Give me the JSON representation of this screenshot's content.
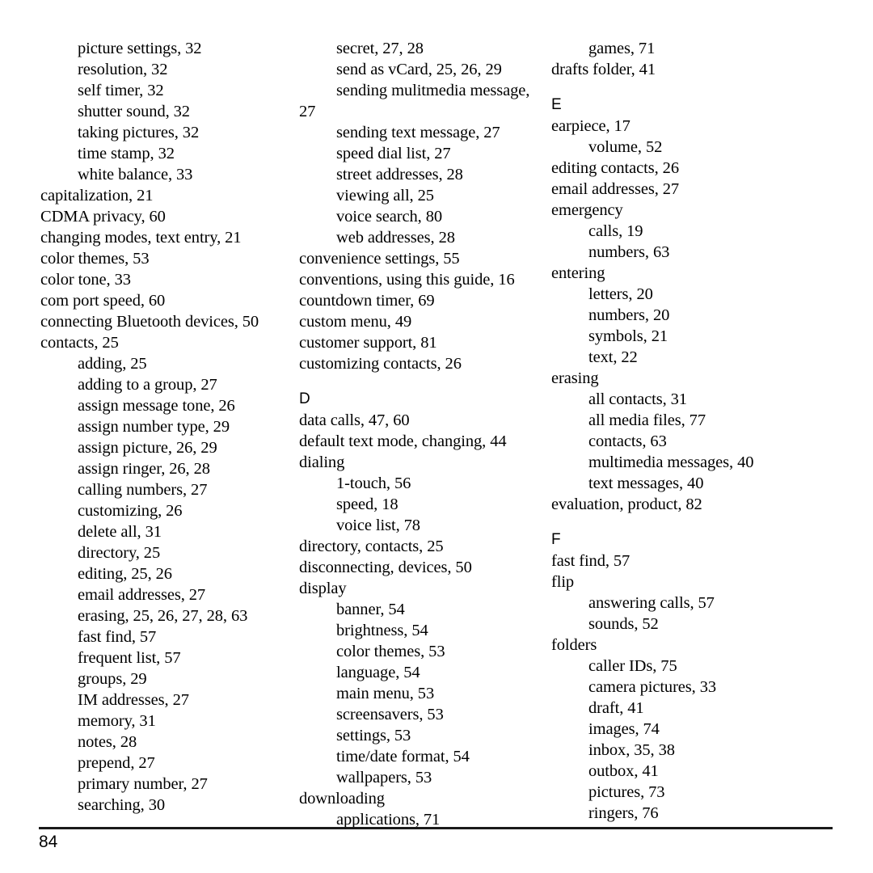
{
  "page": {
    "number": "84",
    "type": "index"
  },
  "columns": [
    {
      "name": "column-1",
      "lines": [
        {
          "level": 1,
          "text": "picture settings, 32"
        },
        {
          "level": 1,
          "text": "resolution, 32"
        },
        {
          "level": 1,
          "text": "self timer, 32"
        },
        {
          "level": 1,
          "text": "shutter sound, 32"
        },
        {
          "level": 1,
          "text": "taking pictures, 32"
        },
        {
          "level": 1,
          "text": "time stamp, 32"
        },
        {
          "level": 1,
          "text": "white balance, 33"
        },
        {
          "level": 0,
          "text": "capitalization, 21"
        },
        {
          "level": 0,
          "text": "CDMA privacy, 60"
        },
        {
          "level": 0,
          "text": "changing modes, text entry, 21"
        },
        {
          "level": 0,
          "text": "color themes, 53"
        },
        {
          "level": 0,
          "text": "color tone, 33"
        },
        {
          "level": 0,
          "text": "com port speed, 60"
        },
        {
          "level": 0,
          "text": "connecting Bluetooth devices, 50"
        },
        {
          "level": 0,
          "text": "contacts, 25"
        },
        {
          "level": 1,
          "text": "adding, 25"
        },
        {
          "level": 1,
          "text": "adding to a group, 27"
        },
        {
          "level": 1,
          "text": "assign message tone, 26"
        },
        {
          "level": 1,
          "text": "assign number type, 29"
        },
        {
          "level": 1,
          "text": "assign picture, 26, 29"
        },
        {
          "level": 1,
          "text": "assign ringer, 26, 28"
        },
        {
          "level": 1,
          "text": "calling numbers, 27"
        },
        {
          "level": 1,
          "text": "customizing, 26"
        },
        {
          "level": 1,
          "text": "delete all, 31"
        },
        {
          "level": 1,
          "text": "directory, 25"
        },
        {
          "level": 1,
          "text": "editing, 25, 26"
        },
        {
          "level": 1,
          "text": "email addresses, 27"
        },
        {
          "level": 1,
          "text": "erasing, 25, 26, 27, 28, 63"
        },
        {
          "level": 1,
          "text": "fast find, 57"
        },
        {
          "level": 1,
          "text": "frequent list, 57"
        },
        {
          "level": 1,
          "text": "groups, 29"
        },
        {
          "level": 1,
          "text": "IM addresses, 27"
        },
        {
          "level": 1,
          "text": "memory, 31"
        },
        {
          "level": 1,
          "text": "notes, 28"
        },
        {
          "level": 1,
          "text": "prepend, 27"
        },
        {
          "level": 1,
          "text": "primary number, 27"
        },
        {
          "level": 1,
          "text": "searching, 30"
        }
      ]
    },
    {
      "name": "column-2",
      "lines": [
        {
          "level": 1,
          "text": "secret, 27, 28"
        },
        {
          "level": 1,
          "text": "send as vCard, 25, 26, 29"
        },
        {
          "level": 1,
          "text": "sending mulitmedia message,"
        },
        {
          "level": "wrap",
          "text": "27"
        },
        {
          "level": 1,
          "text": "sending text message, 27"
        },
        {
          "level": 1,
          "text": "speed dial list, 27"
        },
        {
          "level": 1,
          "text": "street addresses, 28"
        },
        {
          "level": 1,
          "text": "viewing all, 25"
        },
        {
          "level": 1,
          "text": "voice search, 80"
        },
        {
          "level": 1,
          "text": "web addresses, 28"
        },
        {
          "level": 0,
          "text": "convenience settings, 55"
        },
        {
          "level": 0,
          "text": "conventions, using this guide, 16"
        },
        {
          "level": 0,
          "text": "countdown timer, 69"
        },
        {
          "level": 0,
          "text": "custom menu, 49"
        },
        {
          "level": 0,
          "text": "customer support, 81"
        },
        {
          "level": 0,
          "text": "customizing contacts, 26"
        },
        {
          "level": "letter",
          "text": "D"
        },
        {
          "level": 0,
          "text": "data calls, 47, 60"
        },
        {
          "level": 0,
          "text": "default text mode, changing, 44"
        },
        {
          "level": 0,
          "text": "dialing"
        },
        {
          "level": 1,
          "text": "1-touch, 56"
        },
        {
          "level": 1,
          "text": "speed, 18"
        },
        {
          "level": 1,
          "text": "voice list, 78"
        },
        {
          "level": 0,
          "text": "directory, contacts, 25"
        },
        {
          "level": 0,
          "text": "disconnecting, devices, 50"
        },
        {
          "level": 0,
          "text": "display"
        },
        {
          "level": 1,
          "text": "banner, 54"
        },
        {
          "level": 1,
          "text": "brightness, 54"
        },
        {
          "level": 1,
          "text": "color themes, 53"
        },
        {
          "level": 1,
          "text": "language, 54"
        },
        {
          "level": 1,
          "text": "main menu, 53"
        },
        {
          "level": 1,
          "text": "screensavers, 53"
        },
        {
          "level": 1,
          "text": "settings, 53"
        },
        {
          "level": 1,
          "text": "time/date format, 54"
        },
        {
          "level": 1,
          "text": "wallpapers, 53"
        },
        {
          "level": 0,
          "text": "downloading"
        },
        {
          "level": 1,
          "text": "applications, 71"
        }
      ]
    },
    {
      "name": "column-3",
      "lines": [
        {
          "level": 1,
          "text": "games, 71"
        },
        {
          "level": 0,
          "text": "drafts folder, 41"
        },
        {
          "level": "letter",
          "text": "E"
        },
        {
          "level": 0,
          "text": "earpiece, 17"
        },
        {
          "level": 1,
          "text": "volume, 52"
        },
        {
          "level": 0,
          "text": "editing contacts, 26"
        },
        {
          "level": 0,
          "text": "email addresses, 27"
        },
        {
          "level": 0,
          "text": "emergency"
        },
        {
          "level": 1,
          "text": "calls, 19"
        },
        {
          "level": 1,
          "text": "numbers, 63"
        },
        {
          "level": 0,
          "text": "entering"
        },
        {
          "level": 1,
          "text": "letters, 20"
        },
        {
          "level": 1,
          "text": "numbers, 20"
        },
        {
          "level": 1,
          "text": "symbols, 21"
        },
        {
          "level": 1,
          "text": "text, 22"
        },
        {
          "level": 0,
          "text": "erasing"
        },
        {
          "level": 1,
          "text": "all contacts, 31"
        },
        {
          "level": 1,
          "text": "all media files, 77"
        },
        {
          "level": 1,
          "text": "contacts, 63"
        },
        {
          "level": 1,
          "text": "multimedia messages, 40"
        },
        {
          "level": 1,
          "text": "text messages, 40"
        },
        {
          "level": 0,
          "text": "evaluation, product, 82"
        },
        {
          "level": "letter",
          "text": "F"
        },
        {
          "level": 0,
          "text": "fast find, 57"
        },
        {
          "level": 0,
          "text": "flip"
        },
        {
          "level": 1,
          "text": "answering calls, 57"
        },
        {
          "level": 1,
          "text": "sounds, 52"
        },
        {
          "level": 0,
          "text": "folders"
        },
        {
          "level": 1,
          "text": "caller IDs, 75"
        },
        {
          "level": 1,
          "text": "camera pictures, 33"
        },
        {
          "level": 1,
          "text": "draft, 41"
        },
        {
          "level": 1,
          "text": "images, 74"
        },
        {
          "level": 1,
          "text": "inbox, 35, 38"
        },
        {
          "level": 1,
          "text": "outbox, 41"
        },
        {
          "level": 1,
          "text": "pictures, 73"
        },
        {
          "level": 1,
          "text": "ringers, 76"
        }
      ]
    }
  ]
}
